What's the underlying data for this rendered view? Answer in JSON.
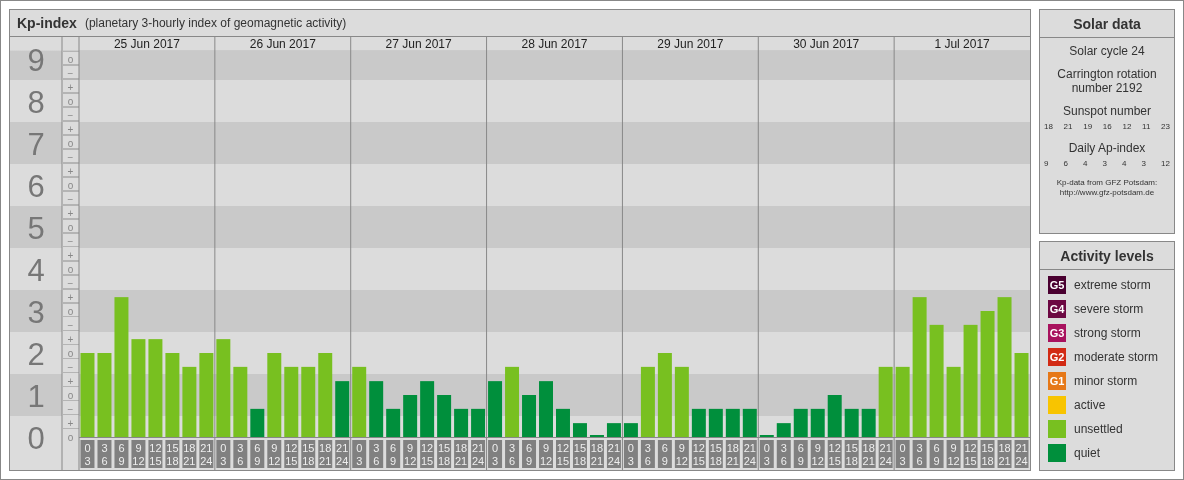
{
  "kp_panel": {
    "title": "Kp-index",
    "subtitle": "(planetary 3-hourly index of geomagnetic activity)",
    "scale_marks": [
      "o",
      "−",
      "+",
      "o",
      "−",
      "+",
      "o",
      "−",
      "+",
      "o",
      "−",
      "+",
      "o",
      "−",
      "+",
      "o",
      "−",
      "+",
      "o",
      "−",
      "+",
      "o",
      "−",
      "+",
      "o",
      "−",
      "+",
      "o"
    ],
    "days": [
      "25 Jun 2017",
      "26 Jun 2017",
      "27 Jun 2017",
      "28 Jun 2017",
      "29 Jun 2017",
      "30 Jun 2017",
      "1 Jul 2017"
    ],
    "chart_data": {
      "type": "bar",
      "grid": true,
      "ylim": [
        0,
        9.2
      ],
      "yticks": [
        0,
        1,
        2,
        3,
        4,
        5,
        6,
        7,
        8,
        9
      ],
      "categories": [
        [
          "0",
          "3"
        ],
        [
          "3",
          "6"
        ],
        [
          "6",
          "9"
        ],
        [
          "9",
          "12"
        ],
        [
          "12",
          "15"
        ],
        [
          "15",
          "18"
        ],
        [
          "18",
          "21"
        ],
        [
          "21",
          "24"
        ],
        [
          "0",
          "3"
        ],
        [
          "3",
          "6"
        ],
        [
          "6",
          "9"
        ],
        [
          "9",
          "12"
        ],
        [
          "12",
          "15"
        ],
        [
          "15",
          "18"
        ],
        [
          "18",
          "21"
        ],
        [
          "21",
          "24"
        ],
        [
          "0",
          "3"
        ],
        [
          "3",
          "6"
        ],
        [
          "6",
          "9"
        ],
        [
          "9",
          "12"
        ],
        [
          "12",
          "15"
        ],
        [
          "15",
          "18"
        ],
        [
          "18",
          "21"
        ],
        [
          "21",
          "24"
        ],
        [
          "0",
          "3"
        ],
        [
          "3",
          "6"
        ],
        [
          "6",
          "9"
        ],
        [
          "9",
          "12"
        ],
        [
          "12",
          "15"
        ],
        [
          "15",
          "18"
        ],
        [
          "18",
          "21"
        ],
        [
          "21",
          "24"
        ],
        [
          "0",
          "3"
        ],
        [
          "3",
          "6"
        ],
        [
          "6",
          "9"
        ],
        [
          "9",
          "12"
        ],
        [
          "12",
          "15"
        ],
        [
          "15",
          "18"
        ],
        [
          "18",
          "21"
        ],
        [
          "21",
          "24"
        ],
        [
          "0",
          "3"
        ],
        [
          "3",
          "6"
        ],
        [
          "6",
          "9"
        ],
        [
          "9",
          "12"
        ],
        [
          "12",
          "15"
        ],
        [
          "15",
          "18"
        ],
        [
          "18",
          "21"
        ],
        [
          "21",
          "24"
        ],
        [
          "0",
          "3"
        ],
        [
          "3",
          "6"
        ],
        [
          "6",
          "9"
        ],
        [
          "9",
          "12"
        ],
        [
          "12",
          "15"
        ],
        [
          "15",
          "18"
        ],
        [
          "18",
          "21"
        ],
        [
          "21",
          "24"
        ]
      ],
      "series": [
        {
          "values": [
            2,
            2,
            3.33,
            2.33,
            2.33,
            2,
            1.67,
            2,
            2.33,
            1.67,
            0.67,
            2,
            1.67,
            1.67,
            2,
            1.33,
            1.67,
            1.33,
            0.67,
            1,
            1.33,
            1,
            0.67,
            0.67,
            1.33,
            1.67,
            1,
            1.33,
            0.67,
            0.33,
            0,
            0.33,
            0.33,
            1.67,
            2,
            1.67,
            0.67,
            0.67,
            0.67,
            0.67,
            0,
            0.33,
            0.67,
            0.67,
            1,
            0.67,
            0.67,
            1.67,
            1.67,
            3.33,
            2.67,
            1.67,
            2.67,
            3,
            3.33,
            2
          ]
        }
      ]
    }
  },
  "solar_data": {
    "title": "Solar data",
    "cycle": "Solar cycle 24",
    "carrington": "Carrington rotation number 2192",
    "sunspot_title": "Sunspot number",
    "sunspots": [
      "18",
      "21",
      "19",
      "16",
      "12",
      "11",
      "23"
    ],
    "ap_title": "Daily Ap-index",
    "ap": [
      "9",
      "6",
      "4",
      "3",
      "4",
      "3",
      "12"
    ],
    "source": "Kp-data from GFZ Potsdam:",
    "source_url": "http://www.gfz-potsdam.de"
  },
  "activity_levels": {
    "title": "Activity levels",
    "items": [
      {
        "badge": "G5",
        "label": "extreme storm",
        "color": "#4a0030"
      },
      {
        "badge": "G4",
        "label": "severe storm",
        "color": "#6c0842"
      },
      {
        "badge": "G3",
        "label": "strong storm",
        "color": "#a8125e"
      },
      {
        "badge": "G2",
        "label": "moderate storm",
        "color": "#d22a14"
      },
      {
        "badge": "G1",
        "label": "minor storm",
        "color": "#e67818"
      },
      {
        "label": "active",
        "color": "#f8c400"
      },
      {
        "label": "unsettled",
        "color": "#78c020"
      },
      {
        "label": "quiet",
        "color": "#008f3c"
      }
    ]
  }
}
